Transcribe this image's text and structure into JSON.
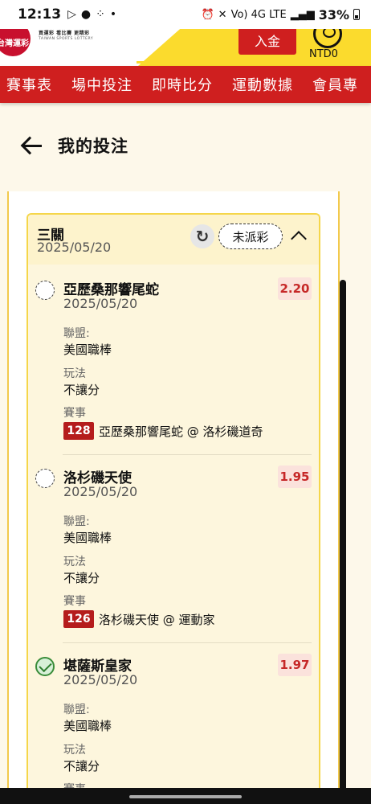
{
  "status_bar": {
    "time": "12:13",
    "network": "Vo) 4G LTE",
    "battery": "33%"
  },
  "header": {
    "logo_main": "台灣運彩",
    "logo_tagline": "買運彩 看比賽 更精彩",
    "logo_english": "TAIWAN SPORTS LOTTERY",
    "deposit_label": "入金",
    "balance": "NTD0",
    "brand_red": "#cf1f1f",
    "brand_yellow": "#fbdb2d"
  },
  "nav": {
    "items": [
      "賽事表",
      "場中投注",
      "即時比分",
      "運動數據",
      "會員專"
    ]
  },
  "page": {
    "title": "我的投注"
  },
  "bet": {
    "type": "三關",
    "date": "2025/05/20",
    "status": "未派彩",
    "legs": [
      {
        "team": "亞歷桑那響尾蛇",
        "date": "2025/05/20",
        "odds": "2.20",
        "league_label": "聯盟:",
        "league": "美國職棒",
        "play_label": "玩法",
        "play": "不讓分",
        "event_label": "賽事",
        "event_id": "128",
        "event_name": "亞歷桑那響尾蛇 @ 洛杉磯道奇",
        "result": "pending"
      },
      {
        "team": "洛杉磯天使",
        "date": "2025/05/20",
        "odds": "1.95",
        "league_label": "聯盟:",
        "league": "美國職棒",
        "play_label": "玩法",
        "play": "不讓分",
        "event_label": "賽事",
        "event_id": "126",
        "event_name": "洛杉磯天使 @ 運動家",
        "result": "pending"
      },
      {
        "team": "堪薩斯皇家",
        "date": "2025/05/20",
        "odds": "1.97",
        "league_label": "聯盟:",
        "league": "美國職棒",
        "play_label": "玩法",
        "play": "不讓分",
        "event_label": "賽事",
        "result": "won"
      }
    ]
  }
}
